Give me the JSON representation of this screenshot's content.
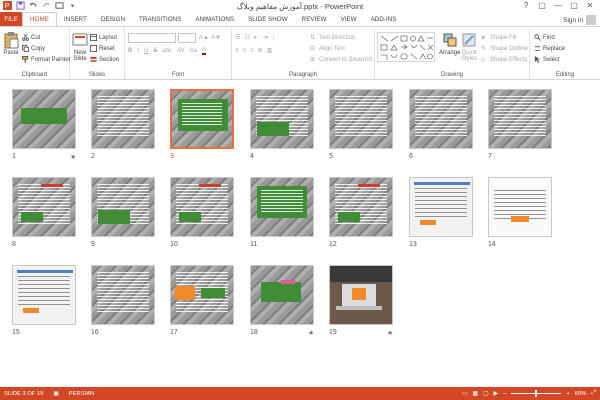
{
  "window": {
    "title": "آموزش مفاهیم وبلاگ.pptx - PowerPoint",
    "controls": [
      "?",
      "▢",
      "—",
      "▢",
      "✕"
    ]
  },
  "tabs": [
    "FILE",
    "HOME",
    "INSERT",
    "DESIGN",
    "TRANSITIONS",
    "ANIMATIONS",
    "SLIDE SHOW",
    "REVIEW",
    "VIEW",
    "ADD-INS"
  ],
  "signin": "Sign in",
  "ribbon": {
    "clipboard": {
      "label": "Clipboard",
      "paste": "Paste",
      "cut": "Cut",
      "copy": "Copy",
      "format_painter": "Format Painter"
    },
    "slides": {
      "label": "Slides",
      "new_slide_1": "New",
      "new_slide_2": "Slide",
      "layout": "Layout",
      "reset": "Reset",
      "section": "Section"
    },
    "font": {
      "label": "Font",
      "bold": "B",
      "italic": "I",
      "underline": "U",
      "strike": "S",
      "shadow": "abc",
      "spacing": "AV",
      "case": "Aa",
      "color": "A"
    },
    "paragraph": {
      "label": "Paragraph",
      "text_direction": "Text Direction",
      "align_text": "Align Text",
      "convert_smartart": "Convert to SmartArt"
    },
    "drawing": {
      "label": "Drawing",
      "arrange": "Arrange",
      "quick_styles_1": "Quick",
      "quick_styles_2": "Styles",
      "shape_fill": "Shape Fill",
      "shape_outline": "Shape Outline",
      "shape_effects": "Shape Effects"
    },
    "editing": {
      "label": "Editing",
      "find": "Find",
      "replace": "Replace",
      "select": "Select"
    }
  },
  "slides": [
    {
      "num": "1",
      "star": "★",
      "selected": false,
      "style": "title-green"
    },
    {
      "num": "2",
      "star": "",
      "selected": false,
      "style": "text-light"
    },
    {
      "num": "3",
      "star": "",
      "selected": true,
      "style": "green-box"
    },
    {
      "num": "4",
      "star": "",
      "selected": false,
      "style": "text-green"
    },
    {
      "num": "5",
      "star": "",
      "selected": false,
      "style": "text-light"
    },
    {
      "num": "6",
      "star": "",
      "selected": false,
      "style": "text-light"
    },
    {
      "num": "7",
      "star": "",
      "selected": false,
      "style": "text-light"
    },
    {
      "num": "8",
      "star": "",
      "selected": false,
      "style": "red-text"
    },
    {
      "num": "9",
      "star": "",
      "selected": false,
      "style": "text-green"
    },
    {
      "num": "10",
      "star": "",
      "selected": false,
      "style": "red-text"
    },
    {
      "num": "11",
      "star": "",
      "selected": false,
      "style": "green-box"
    },
    {
      "num": "12",
      "star": "",
      "selected": false,
      "style": "red-text"
    },
    {
      "num": "13",
      "star": "",
      "selected": false,
      "style": "screenshot"
    },
    {
      "num": "14",
      "star": "",
      "selected": false,
      "style": "screenshot-white"
    },
    {
      "num": "15",
      "star": "",
      "selected": false,
      "style": "screenshot"
    },
    {
      "num": "16",
      "star": "",
      "selected": false,
      "style": "text-light"
    },
    {
      "num": "17",
      "star": "",
      "selected": false,
      "style": "orange-box"
    },
    {
      "num": "18",
      "star": "★",
      "selected": false,
      "style": "pink-green"
    },
    {
      "num": "19",
      "star": "★",
      "selected": false,
      "style": "laptop"
    }
  ],
  "status": {
    "slide": "SLIDE 3 OF 19",
    "language": "PERSIAN",
    "zoom": "60%"
  },
  "colors": {
    "accent": "#d24726",
    "selection": "#e8703b",
    "slide_green": "#3f8d36"
  }
}
